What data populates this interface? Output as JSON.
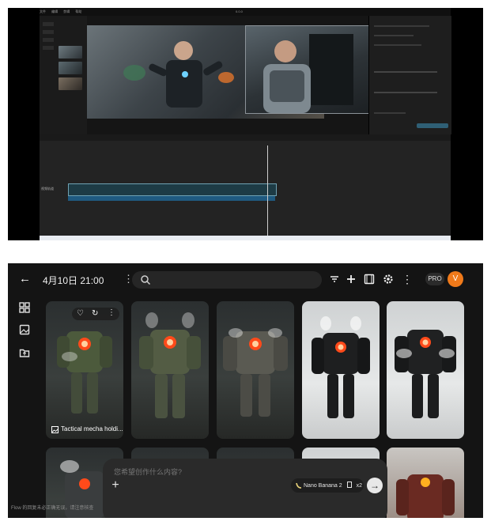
{
  "editor": {
    "menu_items": [
      "文件",
      "编辑",
      "剪辑",
      "帮助"
    ],
    "window_title": "0.0.0",
    "track_label": "视频轨道",
    "colors": {
      "track_border": "#6fa2b3",
      "audio": "#1f5a80",
      "playhead": "#cfcfcf"
    }
  },
  "gallery": {
    "title": "4月10日 21:00",
    "search": {
      "placeholder": "",
      "value": ""
    },
    "toolbar_icons": [
      "filter-icon",
      "plus-icon",
      "filmstrip-icon",
      "gear-icon",
      "more-vertical-icon"
    ],
    "pro_label": "PRO",
    "avatar_initial": "V",
    "sidebar_icons": [
      "grid-icon",
      "image-icon",
      "folder-upload-icon"
    ],
    "first_card_caption": "Tactical mecha holdi...",
    "card_actions": [
      "heart-icon",
      "reuse-icon",
      "more-icon"
    ],
    "prompt": {
      "placeholder": "您希望创作什么内容?",
      "model": "Nano Banana 2",
      "count": "x2"
    },
    "footer_note": "Flow 的回复未必正确无误，请注意核查",
    "colors": {
      "avatar": "#f07a1a",
      "background": "#141414",
      "accent_glow": "#ff4a1a"
    }
  }
}
